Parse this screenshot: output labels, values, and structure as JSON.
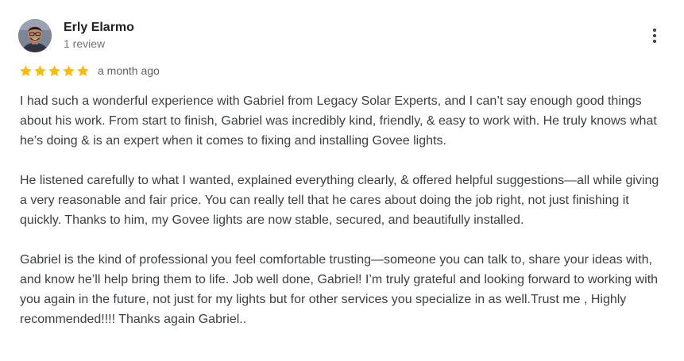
{
  "reviewer": {
    "name": "Erly Elarmo",
    "review_count": "1 review"
  },
  "rating": {
    "stars": 5,
    "max_stars": 5,
    "star_color": "#fbbc04",
    "date": "a month ago"
  },
  "review": {
    "paragraphs": [
      "I had such a wonderful experience with Gabriel from Legacy Solar Experts, and I can’t say enough good things about his work. From start to finish, Gabriel was incredibly kind, friendly, & easy to work with. He truly knows what he’s doing & is an expert when it comes to fixing and installing Govee lights.",
      "He listened carefully to what I wanted, explained everything clearly, & offered helpful suggestions—all while giving a very reasonable and fair price. You can really tell that he cares about doing the job right, not just finishing it quickly. Thanks to him, my Govee lights are now stable, secured, and beautifully installed.",
      "Gabriel is the kind of professional you feel comfortable trusting—someone you can talk to, share your ideas with, and know he’ll help bring them to life. Job well done, Gabriel! I’m truly grateful and looking forward to working with you again in the future, not just for my lights but for other services you specialize in as well.Trust me , Highly recommended!!!! Thanks again Gabriel.."
    ]
  },
  "icons": {
    "more": "more-vert-icon",
    "star": "star-icon"
  }
}
